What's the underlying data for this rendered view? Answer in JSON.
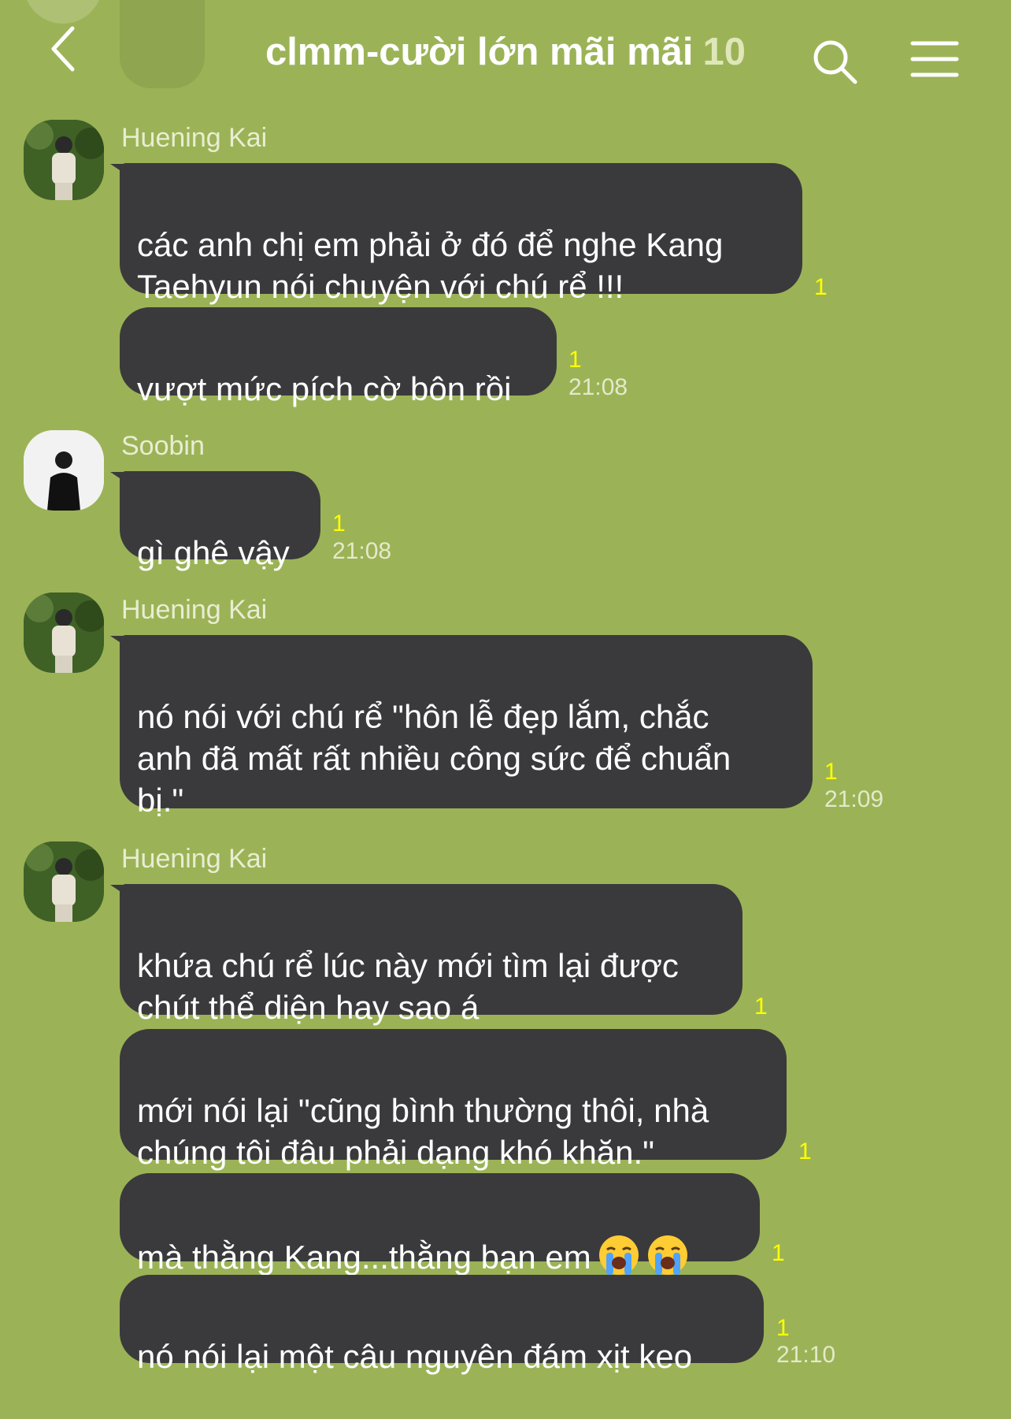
{
  "header": {
    "title": "clmm-cười lớn mãi mãi",
    "member_count": "10",
    "back_icon": "chevron-left-icon",
    "search_icon": "search-icon",
    "menu_icon": "hamburger-menu-icon"
  },
  "colors": {
    "background": "#9bb356",
    "bubble": "#3a3a3c",
    "unread": "#ffff00",
    "timestamp": "#e4e9cb"
  },
  "messages": [
    {
      "sender": "Huening Kai",
      "bubbles": [
        {
          "text": "các anh chị em phải ở đó để nghe Kang\nTaehyun nói chuyện với chú rể !!!",
          "unread": "1"
        },
        {
          "text": "vượt mức pích cờ bôn rồi",
          "unread": "1",
          "time": "21:08"
        }
      ]
    },
    {
      "sender": "Soobin",
      "bubbles": [
        {
          "text": "gì ghê vậy",
          "unread": "1",
          "time": "21:08"
        }
      ]
    },
    {
      "sender": "Huening Kai",
      "bubbles": [
        {
          "text": "nó nói với chú rể  \"hôn lễ đẹp lắm, chắc\nanh đã mất rất nhiều công sức để chuẩn\nbị.\"",
          "unread": "1",
          "time": "21:09"
        }
      ]
    },
    {
      "sender": "Huening Kai",
      "bubbles": [
        {
          "text": "khứa chú rể lúc này mới tìm lại được\nchút thể diện hay sao á",
          "unread": "1"
        },
        {
          "text": "mới nói lại \"cũng bình thường thôi, nhà\nchúng tôi đâu phải dạng khó khăn.\"",
          "unread": "1"
        },
        {
          "text": "mà thằng Kang...thằng bạn em",
          "emoji": [
            "loudly-crying-face-emoji",
            "loudly-crying-face-emoji"
          ],
          "unread": "1"
        },
        {
          "text": "nó nói lại một câu nguyên đám xịt keo",
          "unread": "1",
          "time": "21:10"
        }
      ]
    }
  ]
}
